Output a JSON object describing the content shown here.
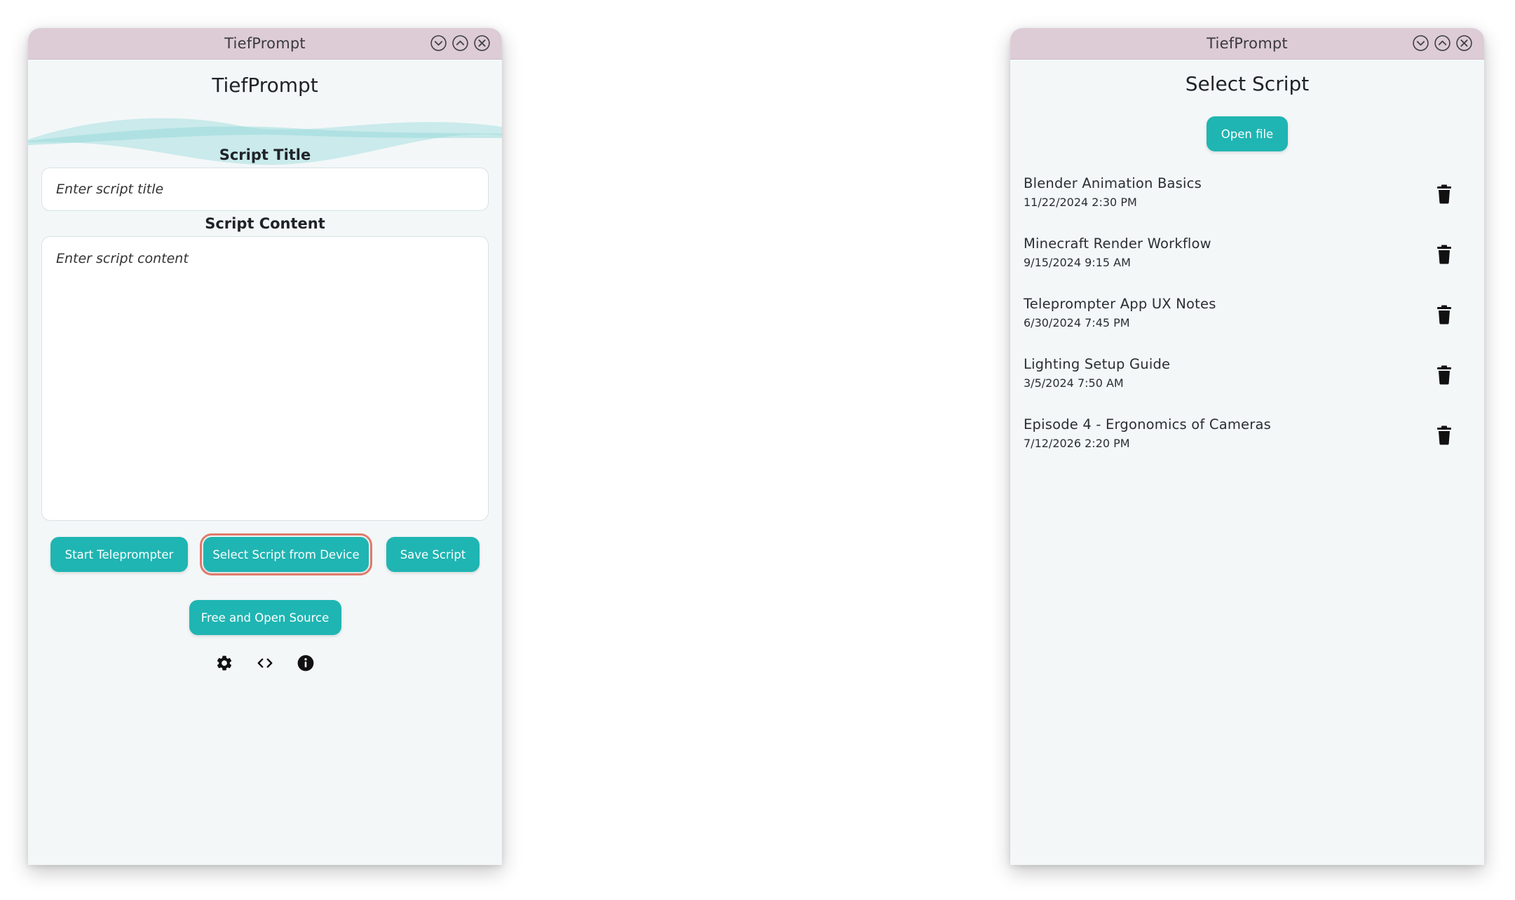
{
  "left_window": {
    "titlebar": {
      "title": "TiefPrompt"
    },
    "heading": "TiefPrompt",
    "script_title": {
      "label": "Script Title",
      "placeholder": "Enter script title"
    },
    "script_content": {
      "label": "Script Content",
      "placeholder": "Enter script content"
    },
    "buttons": {
      "start": "Start Teleprompter",
      "select": "Select Script from Device",
      "save": "Save Script",
      "foss": "Free and Open Source"
    },
    "icons": [
      "gear-icon",
      "code-icon",
      "info-icon"
    ]
  },
  "right_window": {
    "titlebar": {
      "title": "TiefPrompt"
    },
    "heading": "Select Script",
    "open_file_label": "Open file",
    "scripts": [
      {
        "name": "Blender Animation Basics",
        "date": "11/22/2024 2:30 PM"
      },
      {
        "name": "Minecraft Render Workflow",
        "date": "9/15/2024 9:15 AM"
      },
      {
        "name": "Teleprompter App UX Notes",
        "date": "6/30/2024 7:45 PM"
      },
      {
        "name": "Lighting Setup Guide",
        "date": "3/5/2024 7:50 AM"
      },
      {
        "name": "Episode 4 - Ergonomics of Cameras",
        "date": "7/12/2026 2:20 PM"
      }
    ]
  },
  "colors": {
    "accent": "#1fb5b2",
    "titlebar": "#ddccd6",
    "window_bg": "#f3f7f8",
    "highlight_outline": "#e07a6a",
    "wave": "#a8e0e0"
  }
}
